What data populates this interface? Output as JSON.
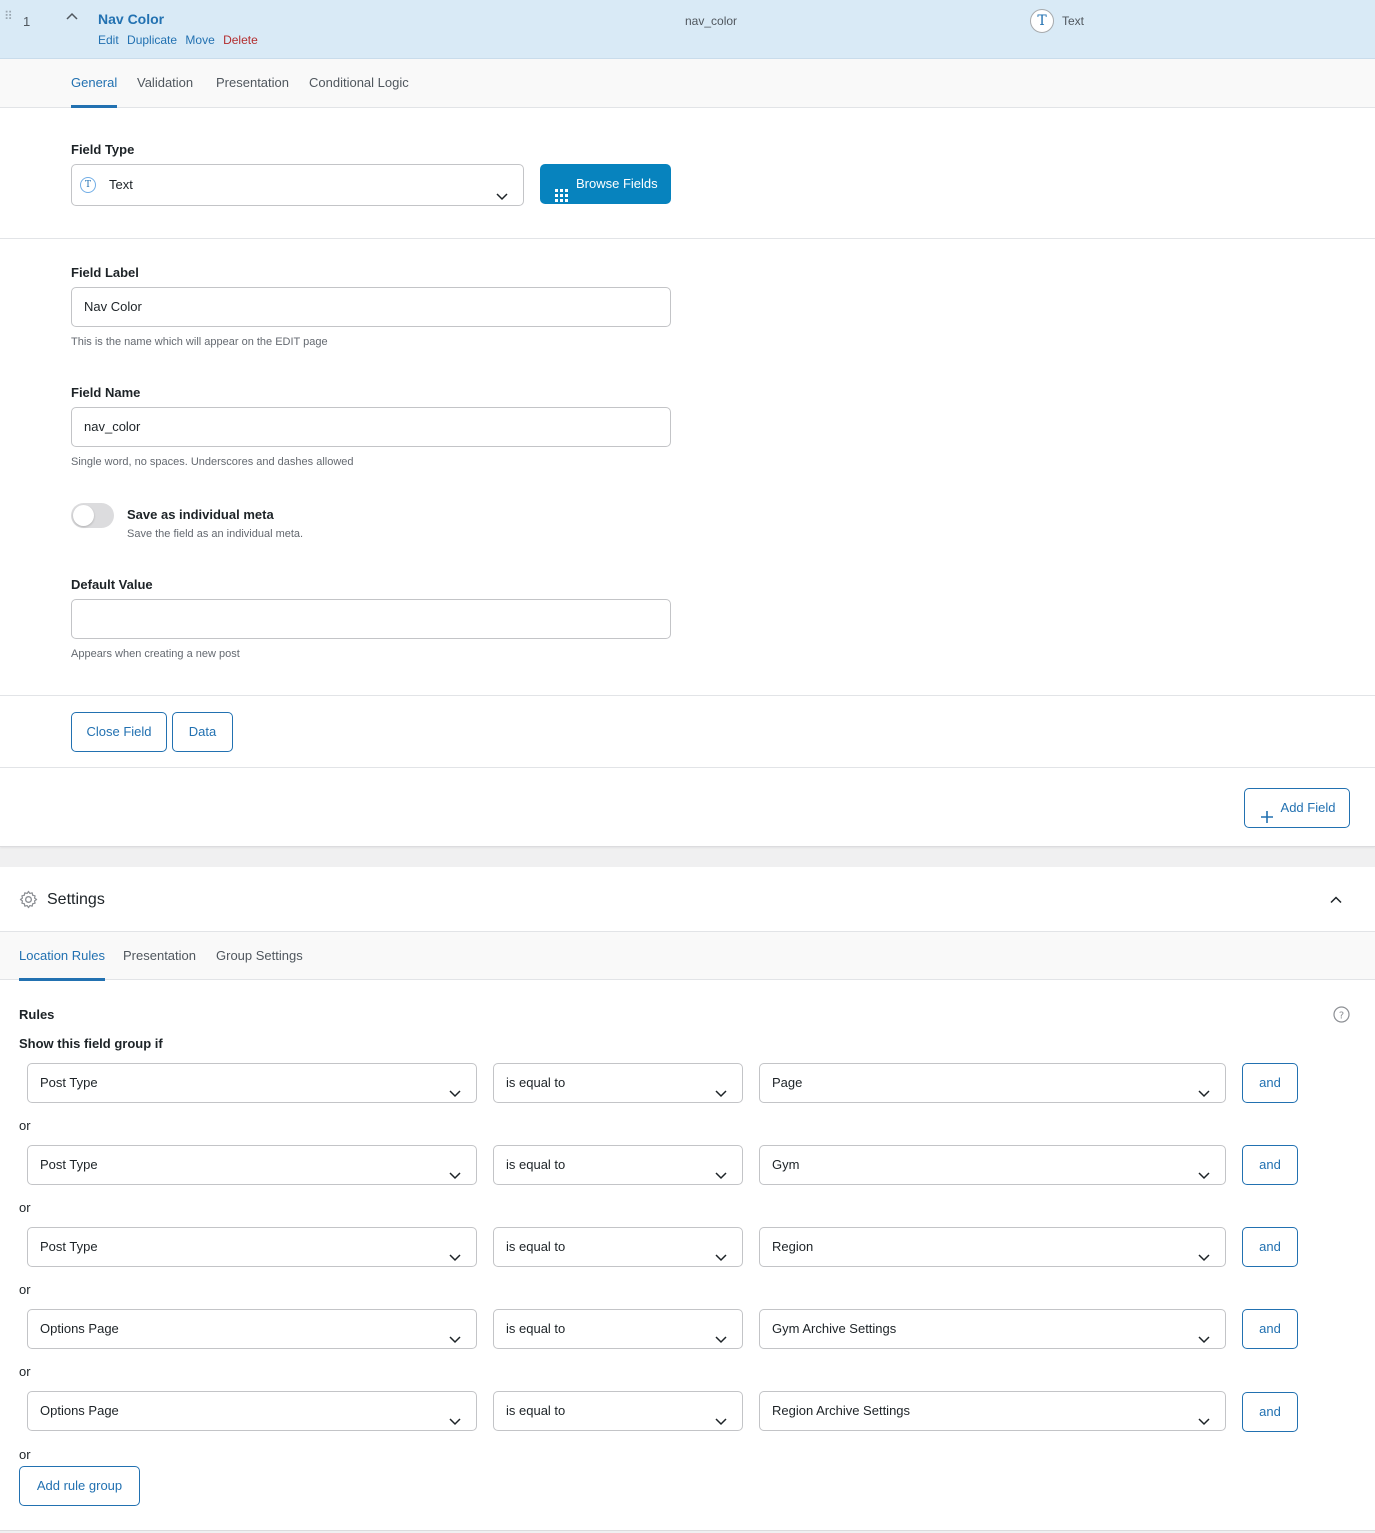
{
  "field_row": {
    "number": "1",
    "title": "Nav Color",
    "actions": {
      "edit": "Edit",
      "duplicate": "Duplicate",
      "move": "Move",
      "delete": "Delete"
    },
    "key": "nav_color",
    "type_icon": "T",
    "type": "Text"
  },
  "field_tabs": [
    "General",
    "Validation",
    "Presentation",
    "Conditional Logic"
  ],
  "field_type": {
    "label": "Field Type",
    "icon": "T",
    "value": "Text",
    "browse_button": "Browse Fields"
  },
  "field_label": {
    "label": "Field Label",
    "value": "Nav Color",
    "description": "This is the name which will appear on the EDIT page"
  },
  "field_name": {
    "label": "Field Name",
    "value": "nav_color",
    "description": "Single word, no spaces. Underscores and dashes allowed"
  },
  "save_meta": {
    "label": "Save as individual meta",
    "description": "Save the field as an individual meta.",
    "enabled": false
  },
  "default_value": {
    "label": "Default Value",
    "value": "",
    "description": "Appears when creating a new post"
  },
  "footer_buttons": {
    "close": "Close Field",
    "data": "Data"
  },
  "add_field": "Add Field",
  "settings": {
    "title": "Settings",
    "tabs": [
      "Location Rules",
      "Presentation",
      "Group Settings"
    ],
    "rules_label": "Rules",
    "show_if": "Show this field group if",
    "or_label": "or",
    "and_label": "and",
    "rules": [
      {
        "param": "Post Type",
        "operator": "is equal to",
        "value": "Page"
      },
      {
        "param": "Post Type",
        "operator": "is equal to",
        "value": "Gym"
      },
      {
        "param": "Post Type",
        "operator": "is equal to",
        "value": "Region"
      },
      {
        "param": "Options Page",
        "operator": "is equal to",
        "value": "Gym Archive Settings"
      },
      {
        "param": "Options Page",
        "operator": "is equal to",
        "value": "Region Archive Settings"
      }
    ],
    "add_rule_group": "Add rule group"
  },
  "colors": {
    "accent": "#2271b1",
    "primary_button": "#0783be",
    "row_highlight": "#d9eaf6",
    "delete": "#b32d2e"
  }
}
